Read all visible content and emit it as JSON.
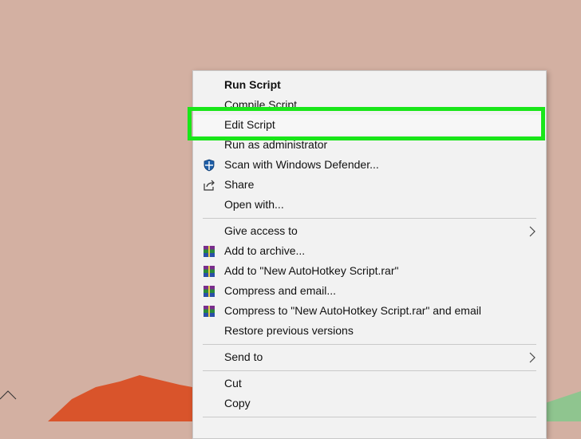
{
  "context_menu": {
    "items": [
      {
        "label": "Run Script",
        "bold": true
      },
      {
        "label": "Compile Script"
      },
      {
        "label": "Edit Script"
      },
      {
        "label": "Run as administrator"
      },
      {
        "label": "Scan with Windows Defender...",
        "icon": "windows-defender-shield-icon"
      },
      {
        "label": "Share",
        "icon": "share-icon"
      },
      {
        "label": "Open with..."
      },
      {
        "label": "Give access to",
        "submenu": true
      },
      {
        "label": "Add to archive...",
        "icon": "winrar-icon"
      },
      {
        "label": "Add to \"New AutoHotkey Script.rar\"",
        "icon": "winrar-icon"
      },
      {
        "label": "Compress and email...",
        "icon": "winrar-icon"
      },
      {
        "label": "Compress to \"New AutoHotkey Script.rar\" and email",
        "icon": "winrar-icon"
      },
      {
        "label": "Restore previous versions"
      },
      {
        "label": "Send to",
        "submenu": true
      },
      {
        "label": "Cut"
      },
      {
        "label": "Copy"
      }
    ]
  },
  "highlight": {
    "target": "Edit Script",
    "color": "#19e619"
  },
  "colors": {
    "desktop": "#d3b0a2",
    "menu_bg": "#f2f2f2",
    "mountain": "#d9542b"
  }
}
